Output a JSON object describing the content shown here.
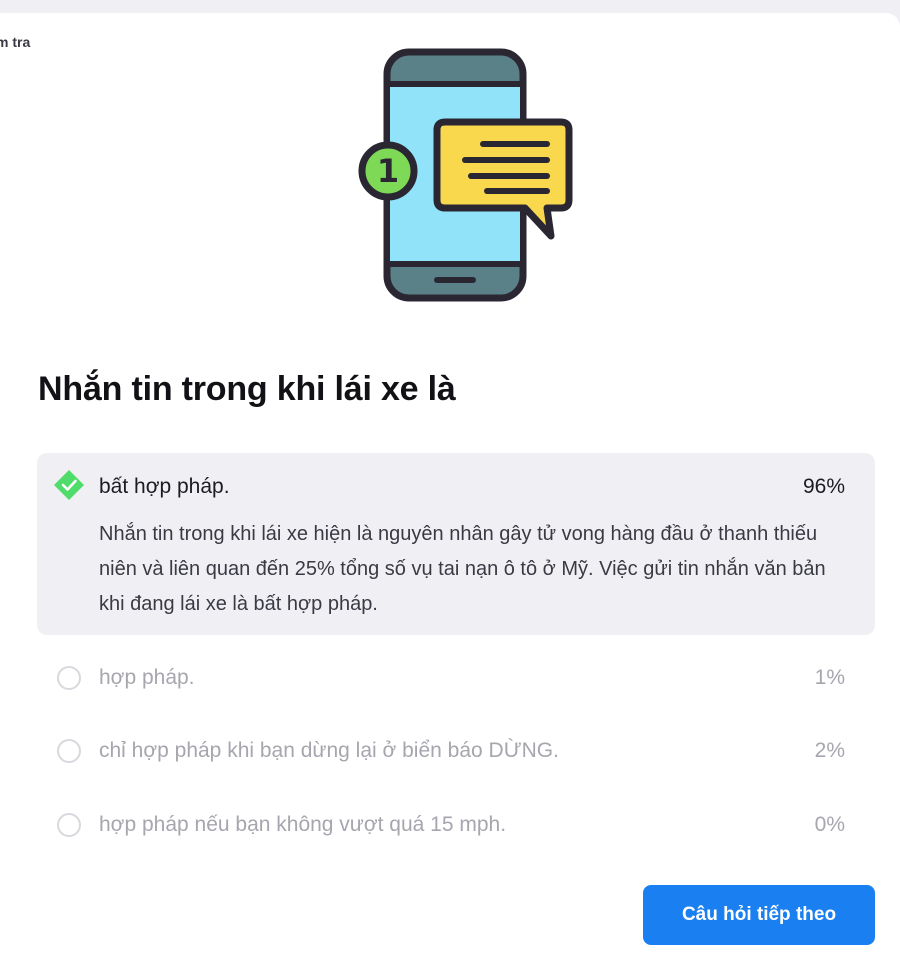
{
  "breadcrumb": "m tra",
  "question": {
    "title": "Nhắn tin trong khi lái xe là"
  },
  "answers": [
    {
      "label": "bất hợp pháp.",
      "percent": "96%",
      "selected": true,
      "correct": true,
      "explanation": "Nhắn tin trong khi lái xe hiện là nguyên nhân gây tử vong hàng đầu ở thanh thiếu niên và liên quan đến 25% tổng số vụ tai nạn ô tô ở Mỹ. Việc gửi tin nhắn văn bản khi đang lái xe là bất hợp pháp."
    },
    {
      "label": "hợp pháp.",
      "percent": "1%",
      "selected": false
    },
    {
      "label": "chỉ hợp pháp khi bạn dừng lại ở biển báo DỪNG.",
      "percent": "2%",
      "selected": false
    },
    {
      "label": "hợp pháp nếu bạn không vượt quá 15 mph.",
      "percent": "0%",
      "selected": false
    }
  ],
  "illustration": {
    "icon": "phone-message-icon",
    "badge_number": "1"
  },
  "next_button": {
    "label": "Câu hỏi tiếp theo"
  },
  "colors": {
    "accent": "#1a7ff0",
    "correct": "#4fdc6a",
    "selected_bg": "#f0f0f4"
  }
}
